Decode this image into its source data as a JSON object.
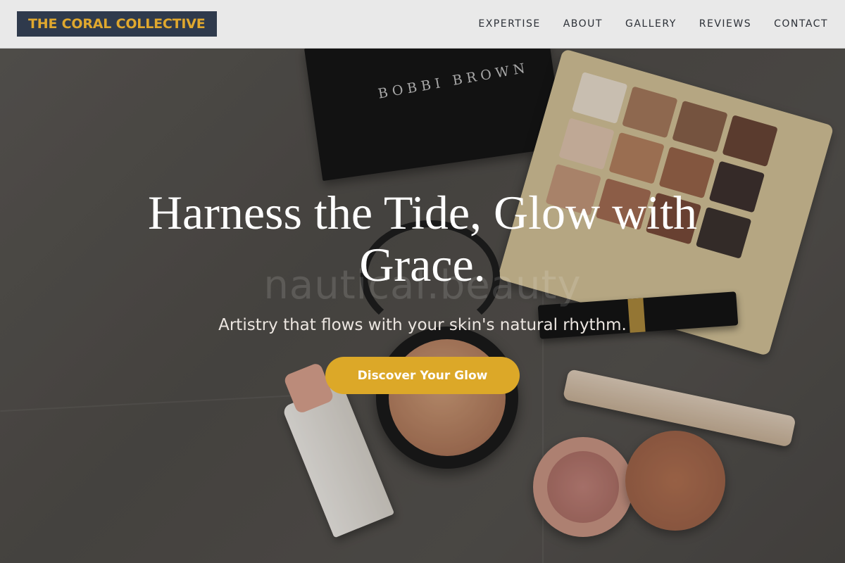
{
  "header": {
    "logo": "THE CORAL COLLECTIVE",
    "nav": [
      {
        "label": "EXPERTISE"
      },
      {
        "label": "ABOUT"
      },
      {
        "label": "GALLERY"
      },
      {
        "label": "REVIEWS"
      },
      {
        "label": "CONTACT"
      }
    ]
  },
  "hero": {
    "title": "Harness the Tide, Glow with Grace.",
    "watermark": "nautical.beauty",
    "subtitle": "Artistry that flows with your skin's natural rhythm.",
    "cta_label": "Discover Your Glow",
    "palette_brand": "BOBBI BROWN"
  },
  "colors": {
    "accent": "#dca828",
    "logo_bg": "#2f3a4c",
    "header_bg": "#e9e9e9"
  }
}
